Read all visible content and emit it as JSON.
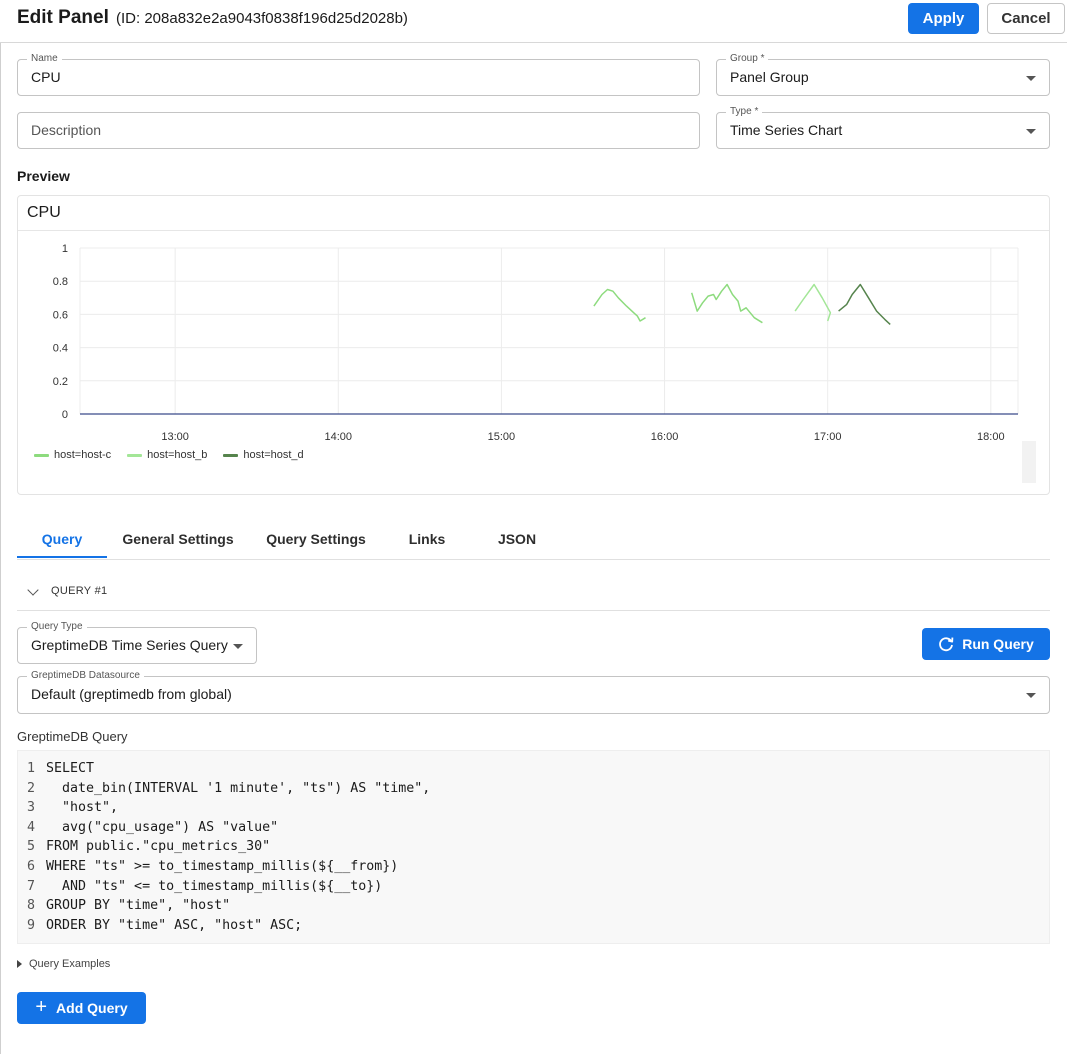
{
  "header": {
    "title": "Edit Panel",
    "subtitle": "(ID: 208a832e2a9043f0838f196d25d2028b)",
    "apply_label": "Apply",
    "cancel_label": "Cancel"
  },
  "form": {
    "name": {
      "label": "Name",
      "value": "CPU"
    },
    "description": {
      "placeholder": "Description"
    },
    "group": {
      "label": "Group *",
      "value": "Panel Group"
    },
    "type": {
      "label": "Type *",
      "value": "Time Series Chart"
    }
  },
  "preview": {
    "section_label": "Preview",
    "panel_title": "CPU"
  },
  "chart_data": {
    "type": "line",
    "title": "CPU",
    "xlabel": "",
    "ylabel": "",
    "ylim": [
      0,
      1
    ],
    "y_ticks": [
      "1",
      "0.8",
      "0.6",
      "0.4",
      "0.2",
      "0"
    ],
    "x_ticks": [
      "13:00",
      "14:00",
      "15:00",
      "16:00",
      "17:00",
      "18:00"
    ],
    "xlim": [
      "12:25",
      "18:10"
    ],
    "grid": true,
    "legend_position": "bottom-left",
    "series": [
      {
        "name": "host=host-c",
        "color": "#8ddb7e",
        "segments": [
          [
            [
              "15:34",
              0.65
            ],
            [
              "15:37",
              0.72
            ],
            [
              "15:39",
              0.75
            ],
            [
              "15:41",
              0.74
            ],
            [
              "15:43",
              0.7
            ],
            [
              "15:46",
              0.65
            ],
            [
              "15:48",
              0.62
            ],
            [
              "15:50",
              0.59
            ],
            [
              "15:51",
              0.56
            ],
            [
              "15:53",
              0.58
            ]
          ],
          [
            [
              "16:10",
              0.73
            ],
            [
              "16:12",
              0.62
            ],
            [
              "16:14",
              0.67
            ],
            [
              "16:16",
              0.71
            ],
            [
              "16:18",
              0.72
            ],
            [
              "16:19",
              0.69
            ],
            [
              "16:21",
              0.74
            ],
            [
              "16:23",
              0.78
            ],
            [
              "16:25",
              0.72
            ],
            [
              "16:27",
              0.68
            ],
            [
              "16:28",
              0.62
            ],
            [
              "16:30",
              0.64
            ],
            [
              "16:33",
              0.58
            ],
            [
              "16:36",
              0.55
            ]
          ]
        ]
      },
      {
        "name": "host=host_b",
        "color": "#a3e697",
        "segments": [
          [
            [
              "16:48",
              0.62
            ],
            [
              "16:51",
              0.69
            ],
            [
              "16:55",
              0.78
            ],
            [
              "16:58",
              0.7
            ],
            [
              "17:01",
              0.61
            ],
            [
              "17:00",
              0.56
            ]
          ]
        ]
      },
      {
        "name": "host=host_d",
        "color": "#56844d",
        "segments": [
          [
            [
              "17:04",
              0.62
            ],
            [
              "17:07",
              0.66
            ],
            [
              "17:09",
              0.72
            ],
            [
              "17:12",
              0.78
            ],
            [
              "17:15",
              0.7
            ],
            [
              "17:18",
              0.62
            ],
            [
              "17:21",
              0.57
            ],
            [
              "17:23",
              0.54
            ]
          ]
        ]
      }
    ]
  },
  "tabs": [
    {
      "label": "Query",
      "active": true
    },
    {
      "label": "General Settings",
      "active": false
    },
    {
      "label": "Query Settings",
      "active": false
    },
    {
      "label": "Links",
      "active": false
    },
    {
      "label": "JSON",
      "active": false
    }
  ],
  "query": {
    "header_label": "QUERY #1",
    "query_type": {
      "label": "Query Type",
      "value": "GreptimeDB Time Series Query"
    },
    "run_label": "Run Query",
    "datasource": {
      "label": "GreptimeDB Datasource",
      "value": "Default (greptimedb from global)"
    },
    "editor_label": "GreptimeDB Query",
    "lines": [
      {
        "n": "1",
        "code": "SELECT"
      },
      {
        "n": "2",
        "code": "  date_bin(INTERVAL '1 minute', \"ts\") AS \"time\","
      },
      {
        "n": "3",
        "code": "  \"host\","
      },
      {
        "n": "4",
        "code": "  avg(\"cpu_usage\") AS \"value\""
      },
      {
        "n": "5",
        "code": "FROM public.\"cpu_metrics_30\""
      },
      {
        "n": "6",
        "code": "WHERE \"ts\" >= to_timestamp_millis(${__from})"
      },
      {
        "n": "7",
        "code": "  AND \"ts\" <= to_timestamp_millis(${__to})"
      },
      {
        "n": "8",
        "code": "GROUP BY \"time\", \"host\""
      },
      {
        "n": "9",
        "code": "ORDER BY \"time\" ASC, \"host\" ASC;"
      }
    ],
    "examples_label": "Query Examples",
    "add_label": "Add Query"
  },
  "icons": {
    "caret": "caret-down-icon",
    "chevron": "chevron-down-icon",
    "refresh": "refresh-icon",
    "plus": "plus-icon",
    "expand": "triangle-right-icon"
  }
}
